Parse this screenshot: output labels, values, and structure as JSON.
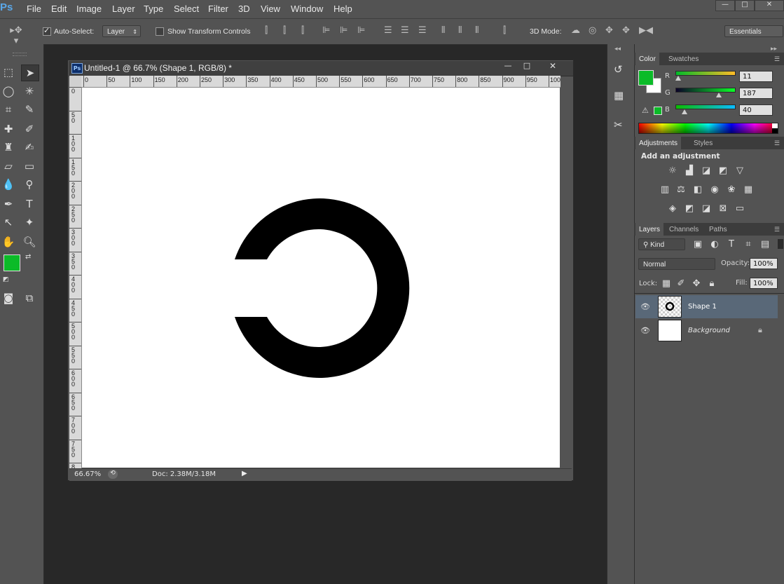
{
  "app": {
    "logo": "Ps"
  },
  "menu": [
    "File",
    "Edit",
    "Image",
    "Layer",
    "Type",
    "Select",
    "Filter",
    "3D",
    "View",
    "Window",
    "Help"
  ],
  "window_controls": {
    "minimize": "—",
    "maximize": "□",
    "close": "✕"
  },
  "options": {
    "auto_select_label": "Auto-Select:",
    "auto_select_checked": true,
    "auto_select_target": "Layer",
    "show_transform_label": "Show Transform Controls",
    "show_transform_checked": false,
    "mode_3d_label": "3D Mode:",
    "workspace": "Essentials"
  },
  "document": {
    "title": "Untitled-1 @ 66.7% (Shape 1, RGB/8) *",
    "tab_icon": "Ps",
    "zoom": "66.67%",
    "doc_size": "Doc: 2.38M/3.18M",
    "hruler_labels": [
      "0",
      "50",
      "100",
      "150",
      "200",
      "250",
      "300",
      "350",
      "400",
      "450",
      "500",
      "550",
      "600",
      "650",
      "700",
      "750",
      "800",
      "850",
      "900",
      "950",
      "100"
    ],
    "vruler_labels": [
      "0",
      "50",
      "100",
      "150",
      "200",
      "250",
      "300",
      "350",
      "400",
      "450",
      "500",
      "550",
      "600",
      "650",
      "700",
      "750",
      "8"
    ],
    "win_min": "—",
    "win_max": "□",
    "win_close": "✕"
  },
  "color_panel": {
    "tabs": [
      "Color",
      "Swatches"
    ],
    "foreground": "#0bbb28",
    "background": "#ffffff",
    "channels": [
      {
        "label": "R",
        "value": "11"
      },
      {
        "label": "G",
        "value": "187"
      },
      {
        "label": "B",
        "value": "40"
      }
    ]
  },
  "adjustments_panel": {
    "tabs": [
      "Adjustments",
      "Styles"
    ],
    "heading": "Add an adjustment"
  },
  "layers_panel": {
    "tabs": [
      "Layers",
      "Channels",
      "Paths"
    ],
    "filter_kind": "Kind",
    "blend_mode": "Normal",
    "opacity_label": "Opacity:",
    "opacity": "100%",
    "lock_label": "Lock:",
    "fill_label": "Fill:",
    "fill": "100%",
    "layers": [
      {
        "name": "Shape 1",
        "selected": true
      },
      {
        "name": "Background",
        "selected": false,
        "locked": true
      }
    ]
  }
}
